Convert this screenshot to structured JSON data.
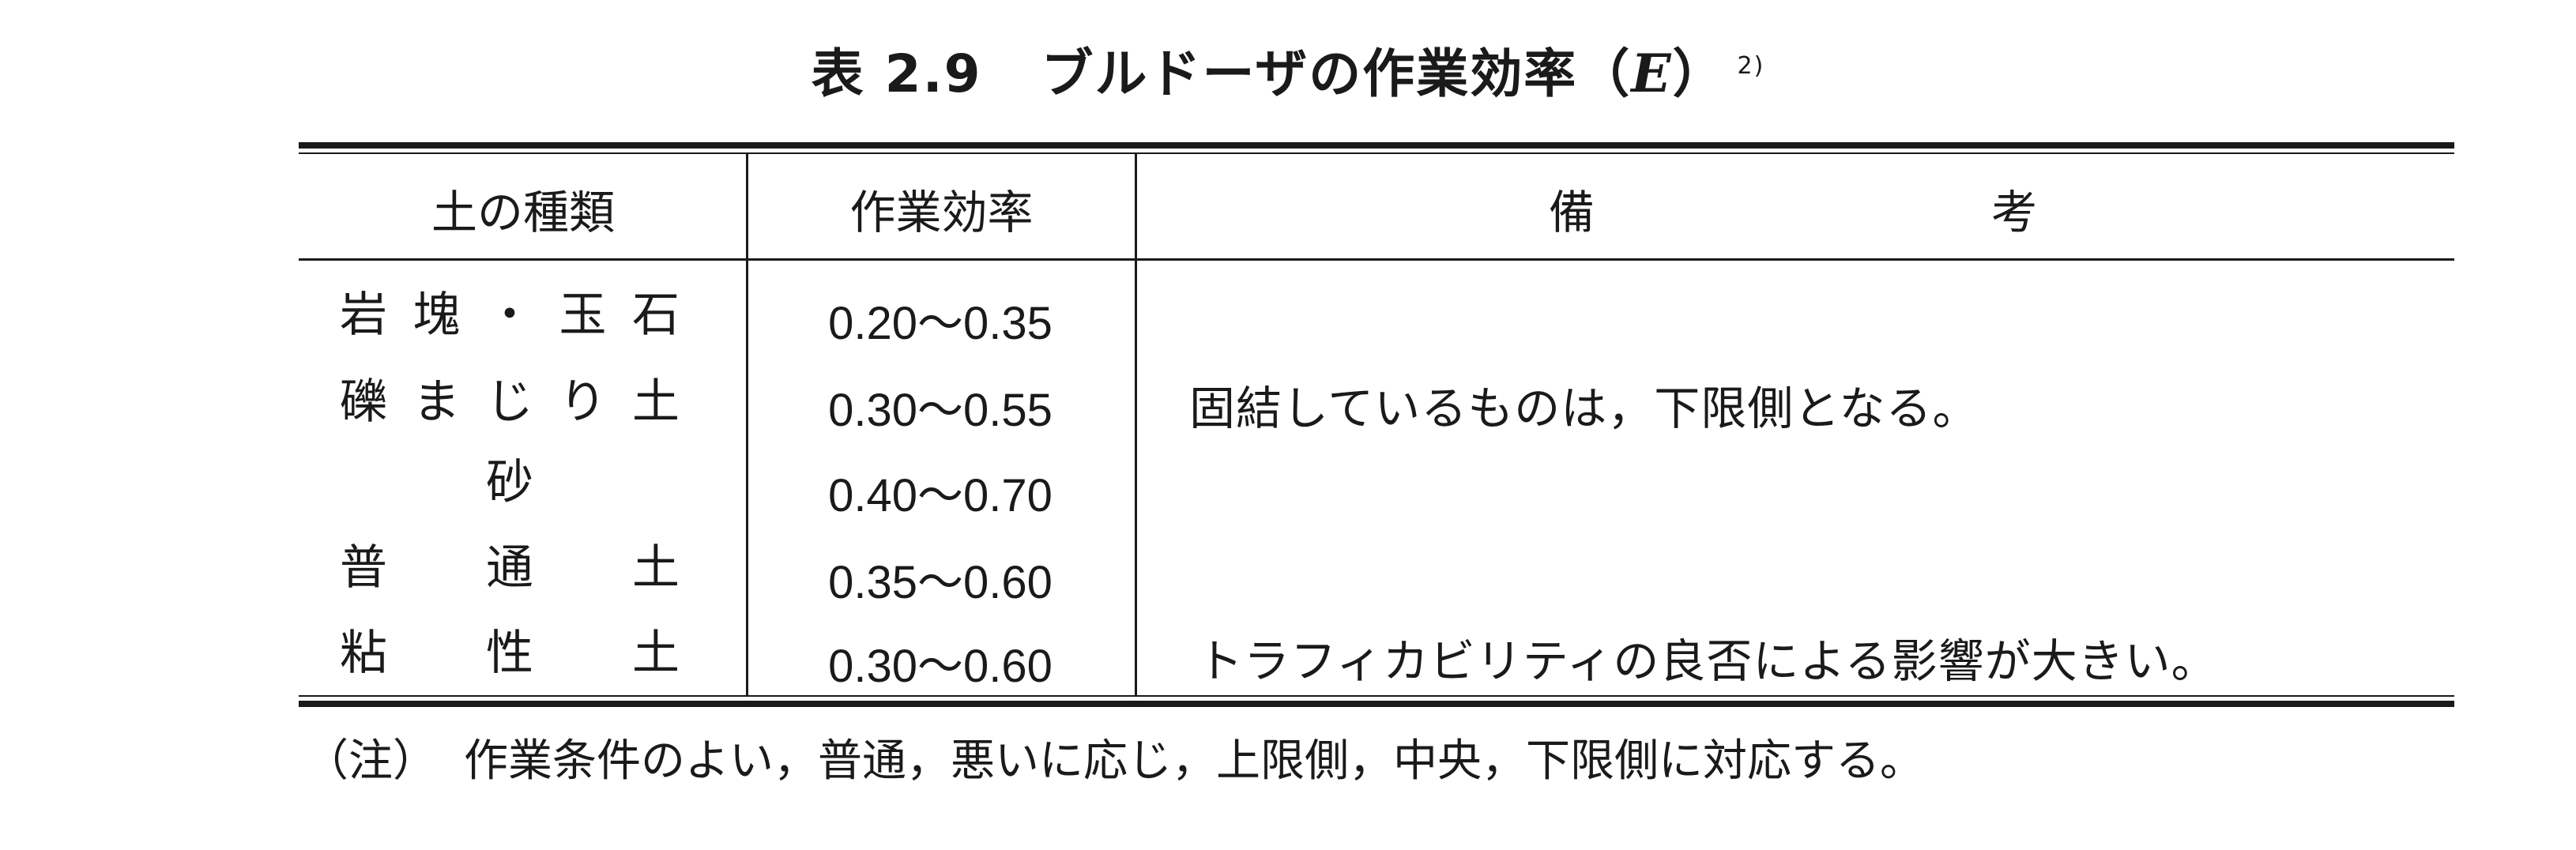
{
  "title": {
    "number": "表 2.9",
    "text": "ブルドーザの作業効率",
    "symbol_open": "（",
    "symbol": "E",
    "symbol_close": "）",
    "ref": "2)"
  },
  "table": {
    "headers": {
      "soil_type": "土の種類",
      "efficiency": "作業効率",
      "remarks_left": "備",
      "remarks_right": "考"
    },
    "rows": [
      {
        "soil": [
          "岩",
          "塊",
          "・",
          "玉",
          "石"
        ],
        "efficiency": "0.20〜0.35"
      },
      {
        "soil": [
          "礫",
          "ま",
          "じ",
          "り",
          "土"
        ],
        "efficiency": "0.30〜0.55"
      },
      {
        "soil": [
          "砂"
        ],
        "efficiency": "0.40〜0.70"
      },
      {
        "soil": [
          "普",
          "通",
          "土"
        ],
        "efficiency": "0.35〜0.60"
      },
      {
        "soil": [
          "粘",
          "性",
          "土"
        ],
        "efficiency": "0.30〜0.60"
      }
    ],
    "remarks": [
      "固結しているものは，下限側となる。",
      "トラフィカビリティの良否による影響が大きい。"
    ]
  },
  "note": {
    "mark": "（注）",
    "text": "作業条件のよい，普通，悪いに応じ，上限側，中央，下限側に対応する。"
  }
}
